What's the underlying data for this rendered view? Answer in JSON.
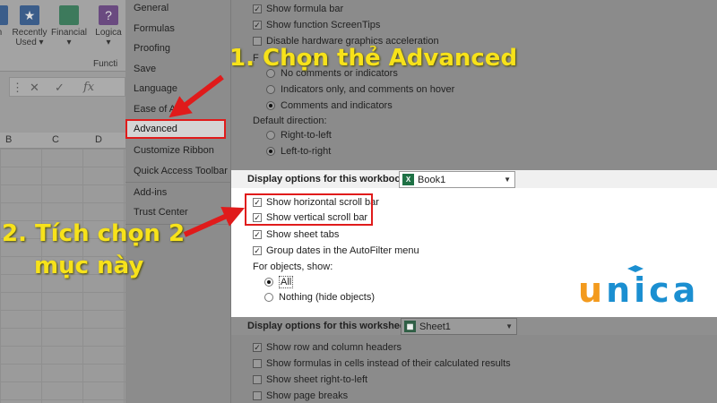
{
  "ribbon": {
    "buttons": [
      {
        "label": "m",
        "icon": "function-icon"
      },
      {
        "label": "Recently",
        "sub": "Used ▾",
        "icon": "star-icon"
      },
      {
        "label": "Financial",
        "sub": "▾",
        "icon": "book-icon"
      },
      {
        "label": "Logica",
        "sub": "▾",
        "icon": "question-icon"
      }
    ],
    "group_label": "Functi",
    "formula_glyphs": [
      "⋮",
      "✕",
      "✓",
      "fx"
    ],
    "columns": [
      "B",
      "C",
      "D"
    ]
  },
  "nav": {
    "items": [
      "General",
      "Formulas",
      "Proofing",
      "Save",
      "Language",
      "Ease of Acc",
      "Advanced",
      "Customize Ribbon",
      "Quick Access Toolbar",
      "Add-ins",
      "Trust Center"
    ],
    "selected": "Advanced"
  },
  "top_options": {
    "show_formula_bar": "Show formula bar",
    "show_screentips": "Show function ScreenTips",
    "disable_hw": "Disable hardware graphics acceleration",
    "comments_label": "F",
    "comments_label_tail": "w:",
    "no_comments": "No comments or indicators",
    "indicators_only": "Indicators only, and comments on hover",
    "comments_and_indicators": "Comments and indicators",
    "default_direction": "Default direction:",
    "rtl": "Right-to-left",
    "ltr": "Left-to-right"
  },
  "workbook": {
    "title": "Display options for this workbook:",
    "selected_book": "Book1",
    "options": {
      "h_scroll": "Show horizontal scroll bar",
      "v_scroll": "Show vertical scroll bar",
      "sheet_tabs": "Show sheet tabs",
      "group_dates": "Group dates in the AutoFilter menu",
      "objects_show": "For objects, show:",
      "all": "All",
      "nothing": "Nothing (hide objects)"
    }
  },
  "worksheet": {
    "title": "Display options for this worksheet:",
    "selected_sheet": "Sheet1",
    "options": {
      "row_col_headers": "Show row and column headers",
      "formulas": "Show formulas in cells instead of their calculated results",
      "sheet_rtl": "Show sheet right-to-left",
      "page_breaks": "Show page breaks"
    }
  },
  "annotations": {
    "step1": "1. Chọn thẻ Advanced",
    "step2_line1": "2. Tích chọn 2",
    "step2_line2": "mục này",
    "arrow_color": "#e01b1b",
    "text_color": "#f7e21a"
  },
  "logo": {
    "u": "u",
    "rest": "nica"
  }
}
